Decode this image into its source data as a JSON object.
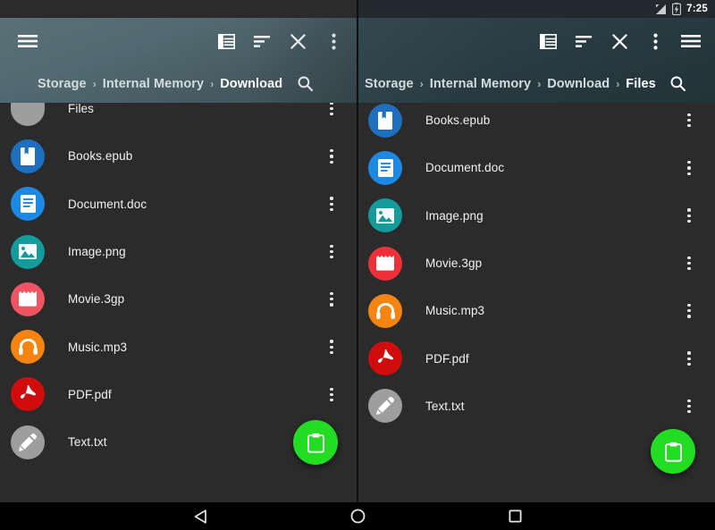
{
  "status_bar": {
    "signal_icon": "signal-cellular-icon",
    "battery_icon": "battery-icon",
    "time": "7:25"
  },
  "colors": {
    "fab_green": "#22dd22",
    "left_header": "#536a72",
    "right_header": "#2a3d44",
    "list_background": "#2b2b2b",
    "folder_gray": "#9e9e9e",
    "epub_blue": "#1e6fbd",
    "doc_blue": "#1e88e5",
    "image_teal": "#149c9c",
    "movie_red": "#ef5462",
    "music_orange": "#f58410",
    "pdf_red": "#d00c0c",
    "text_gray": "#9e9e9e"
  },
  "left_panel": {
    "menu_icon": "hamburger-menu-icon",
    "toolbar_actions": [
      {
        "icon": "grid-view-icon",
        "label": "View mode"
      },
      {
        "icon": "sort-icon",
        "label": "Sort"
      },
      {
        "icon": "close-icon",
        "label": "Close"
      },
      {
        "icon": "overflow-menu-icon",
        "label": "More options"
      }
    ],
    "breadcrumb": [
      {
        "label": "Storage",
        "active": false
      },
      {
        "label": "Internal Memory",
        "active": false
      },
      {
        "label": "Download",
        "active": true
      }
    ],
    "search_icon": "search-icon",
    "files": [
      {
        "name": "Files",
        "icon": "folder-icon",
        "color": "#9e9e9e"
      },
      {
        "name": "Books.epub",
        "icon": "book-icon",
        "color": "#1e6fbd"
      },
      {
        "name": "Document.doc",
        "icon": "document-icon",
        "color": "#1e88e5"
      },
      {
        "name": "Image.png",
        "icon": "image-icon",
        "color": "#149c9c"
      },
      {
        "name": "Movie.3gp",
        "icon": "movie-clapper-icon",
        "color": "#ef5462"
      },
      {
        "name": "Music.mp3",
        "icon": "headphones-icon",
        "color": "#f58410"
      },
      {
        "name": "PDF.pdf",
        "icon": "pdf-icon",
        "color": "#d00c0c"
      },
      {
        "name": "Text.txt",
        "icon": "pencil-icon",
        "color": "#9e9e9e"
      }
    ],
    "row_menu_icon": "kebab-menu-icon",
    "fab": {
      "icon": "clipboard-paste-icon",
      "label": "Paste"
    }
  },
  "right_panel": {
    "toolbar_actions": [
      {
        "icon": "grid-view-icon",
        "label": "View mode"
      },
      {
        "icon": "sort-icon",
        "label": "Sort"
      },
      {
        "icon": "close-icon",
        "label": "Close"
      },
      {
        "icon": "overflow-menu-icon",
        "label": "More options"
      },
      {
        "icon": "hamburger-menu-icon",
        "label": "Navigation drawer"
      }
    ],
    "breadcrumb": [
      {
        "label": "Storage",
        "active": false
      },
      {
        "label": "Internal Memory",
        "active": false
      },
      {
        "label": "Download",
        "active": false
      },
      {
        "label": "Files",
        "active": true
      }
    ],
    "search_icon": "search-icon",
    "files": [
      {
        "name": "Books.epub",
        "icon": "book-icon",
        "color": "#1e6fbd"
      },
      {
        "name": "Document.doc",
        "icon": "document-icon",
        "color": "#1e88e5"
      },
      {
        "name": "Image.png",
        "icon": "image-icon",
        "color": "#149c9c"
      },
      {
        "name": "Movie.3gp",
        "icon": "movie-clapper-icon",
        "color": "#ef3038"
      },
      {
        "name": "Music.mp3",
        "icon": "headphones-icon",
        "color": "#f58410"
      },
      {
        "name": "PDF.pdf",
        "icon": "pdf-icon",
        "color": "#d00c0c"
      },
      {
        "name": "Text.txt",
        "icon": "pencil-icon",
        "color": "#9e9e9e"
      }
    ],
    "row_menu_icon": "kebab-menu-icon",
    "fab": {
      "icon": "clipboard-paste-icon",
      "label": "Paste"
    }
  },
  "navigation_bar": {
    "buttons": [
      {
        "icon": "back-triangle-icon",
        "label": "Back"
      },
      {
        "icon": "home-circle-icon",
        "label": "Home"
      },
      {
        "icon": "recents-square-icon",
        "label": "Recents"
      }
    ]
  }
}
